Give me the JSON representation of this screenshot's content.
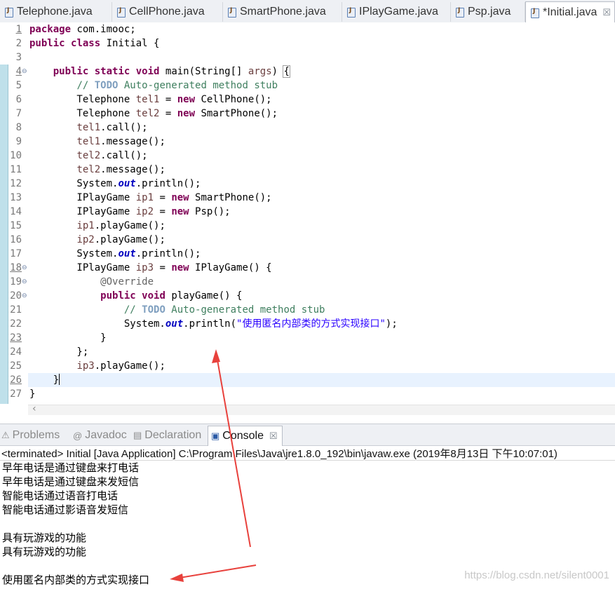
{
  "editor_tabs": [
    {
      "label": "Telephone.java",
      "active": false
    },
    {
      "label": "CellPhone.java",
      "active": false
    },
    {
      "label": "SmartPhone.java",
      "active": false
    },
    {
      "label": "IPlayGame.java",
      "active": false
    },
    {
      "label": "Psp.java",
      "active": false
    },
    {
      "label": "*Initial.java",
      "active": true
    }
  ],
  "close_glyph": "☒",
  "code_lines": [
    {
      "n": "1",
      "html": "<span class='kw'>package</span> com.imooc;"
    },
    {
      "n": "2",
      "html": "<span class='kw'>public</span> <span class='kw'>class</span> Initial {"
    },
    {
      "n": "3",
      "html": ""
    },
    {
      "n": "4",
      "html": "    <span class='kw'>public</span> <span class='kw'>static</span> <span class='kw'>void</span> main(String[] <span class='var'>args</span>) <span class='bracket'>{</span>"
    },
    {
      "n": "5",
      "html": "        <span class='cm'>// </span><span class='todo'>TODO</span><span class='cm'> Auto-generated method stub</span>"
    },
    {
      "n": "6",
      "html": "        Telephone <span class='var'>tel1</span> = <span class='kw'>new</span> CellPhone();"
    },
    {
      "n": "7",
      "html": "        Telephone <span class='var'>tel2</span> = <span class='kw'>new</span> SmartPhone();"
    },
    {
      "n": "8",
      "html": "        <span class='var'>tel1</span>.call();"
    },
    {
      "n": "9",
      "html": "        <span class='var'>tel1</span>.message();"
    },
    {
      "n": "10",
      "html": "        <span class='var'>tel2</span>.call();"
    },
    {
      "n": "11",
      "html": "        <span class='var'>tel2</span>.message();"
    },
    {
      "n": "12",
      "html": "        System.<span class='fld'>out</span>.println();"
    },
    {
      "n": "13",
      "html": "        IPlayGame <span class='var'>ip1</span> = <span class='kw'>new</span> SmartPhone();"
    },
    {
      "n": "14",
      "html": "        IPlayGame <span class='var'>ip2</span> = <span class='kw'>new</span> Psp();"
    },
    {
      "n": "15",
      "html": "        <span class='var'>ip1</span>.playGame();"
    },
    {
      "n": "16",
      "html": "        <span class='var'>ip2</span>.playGame();"
    },
    {
      "n": "17",
      "html": "        System.<span class='fld'>out</span>.println();"
    },
    {
      "n": "18",
      "html": "        IPlayGame <span class='var'>ip3</span> = <span class='kw'>new</span> IPlayGame() {"
    },
    {
      "n": "19",
      "html": "            <span class='ann'>@Override</span>"
    },
    {
      "n": "20",
      "html": "            <span class='kw'>public</span> <span class='kw'>void</span> playGame() {"
    },
    {
      "n": "21",
      "html": "                <span class='cm'>// </span><span class='todo'>TODO</span><span class='cm'> Auto-generated method stub</span>"
    },
    {
      "n": "22",
      "html": "                System.<span class='fld'>out</span>.println(<span class='str'>\"使用匿名内部类的方式实现接口\"</span>);"
    },
    {
      "n": "23",
      "html": "            }"
    },
    {
      "n": "24",
      "html": "        };"
    },
    {
      "n": "25",
      "html": "        <span class='var'>ip3</span>.playGame();"
    },
    {
      "n": "26",
      "html": "    }<span class='caret'></span>"
    },
    {
      "n": "27",
      "html": "}"
    }
  ],
  "view_tabs": [
    {
      "label": "Problems",
      "icon": "⚠",
      "active": false
    },
    {
      "label": "Javadoc",
      "icon": "@",
      "active": false
    },
    {
      "label": "Declaration",
      "icon": "▤",
      "active": false
    },
    {
      "label": "Console",
      "icon": "▣",
      "active": true
    }
  ],
  "console_header": "<terminated> Initial [Java Application] C:\\Program Files\\Java\\jre1.8.0_192\\bin\\javaw.exe (2019年8月13日 下午10:07:01)",
  "console_lines": [
    "早年电话是通过键盘来打电话",
    "早年电话是通过键盘来发短信",
    "智能电话通过语音打电话",
    "智能电话通过影语音发短信",
    "",
    "具有玩游戏的功能",
    "具有玩游戏的功能",
    "",
    "使用匿名内部类的方式实现接口"
  ],
  "watermark": "https://blog.csdn.net/silent0001",
  "colors": {
    "keyword": "#7f0055",
    "comment": "#3f7f5f",
    "string": "#2a00ff",
    "annotation_arrow": "#e8413c"
  }
}
